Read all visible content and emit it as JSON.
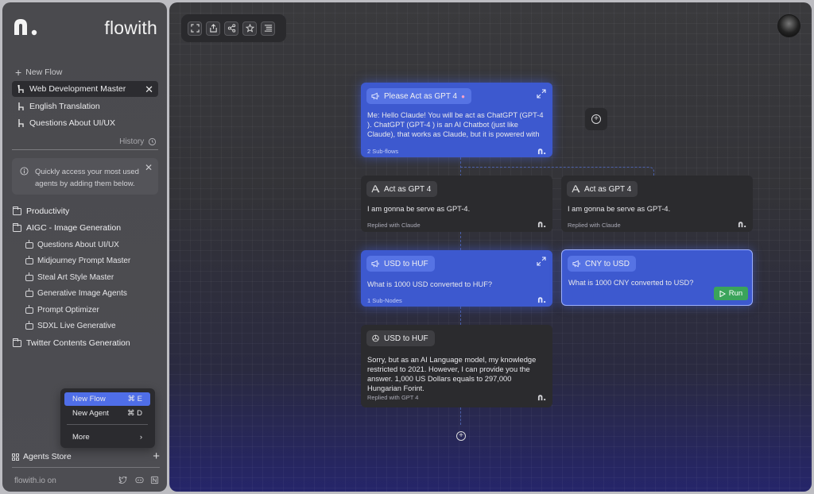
{
  "sidebar": {
    "brand": "flowith",
    "new_flow": "New Flow",
    "flows": [
      {
        "label": "Web Development Master",
        "active": true
      },
      {
        "label": "English Translation",
        "active": false
      },
      {
        "label": "Questions About UI/UX",
        "active": false
      }
    ],
    "history_label": "History",
    "tip": "Quickly access your most used agents by adding them below.",
    "folders": [
      {
        "label": "Productivity"
      },
      {
        "label": "AIGC - Image Generation"
      },
      {
        "label": "Twitter Contents Generation"
      }
    ],
    "agents": [
      "Questions About UI/UX",
      "Midjourney Prompt Master",
      "Steal Art Style Master",
      "Generative Image Agents",
      "Prompt Optimizer",
      "SDXL Live Generative"
    ],
    "menu": {
      "new_flow": {
        "label": "New Flow",
        "shortcut": "⌘ E"
      },
      "new_agent": {
        "label": "New Agent",
        "shortcut": "⌘ D"
      },
      "more": {
        "label": "More",
        "arrow": "›"
      }
    },
    "agents_store": "Agents Store",
    "footer": "flowith.io on"
  },
  "canvas": {
    "toolbar_icons": [
      "fullscreen-icon",
      "share-icon",
      "network-icon",
      "star-icon",
      "list-icon"
    ],
    "cards": {
      "root": {
        "title": "Please Act as GPT 4",
        "body": "Me: Hello Claude! You will be act as ChatGPT (GPT-4 ). ChatGPT (GPT-4 ) is an AI Chatbot (just like Claude), that works as Claude, but it is powered with",
        "meta": "2 Sub-flows"
      },
      "act_left": {
        "title": "Act as GPT 4",
        "body": "I am gonna be serve as GPT-4.",
        "meta": "Replied with Claude"
      },
      "act_right": {
        "title": "Act as GPT 4",
        "body": "I am gonna be serve as GPT-4.",
        "meta": "Replied with Claude"
      },
      "usd_q": {
        "title": "USD to HUF",
        "body": "What is 1000 USD converted to HUF?",
        "meta": "1 Sub-Nodes"
      },
      "cny_q": {
        "title": "CNY to USD",
        "body": "What is 1000 CNY converted to USD?",
        "run": "Run"
      },
      "usd_a": {
        "title": "USD to HUF",
        "body": "Sorry, but as an AI Language model, my knowledge restricted to 2021. However, I can provide you the answer. 1,000 US Dollars equals to 297,000 Hungarian Forint.",
        "meta": "Replied with GPT 4"
      }
    }
  },
  "colors": {
    "accent_blue": "#3d59cf",
    "menu_highlight": "#4f6ee8",
    "run_green": "#3aa45a"
  }
}
